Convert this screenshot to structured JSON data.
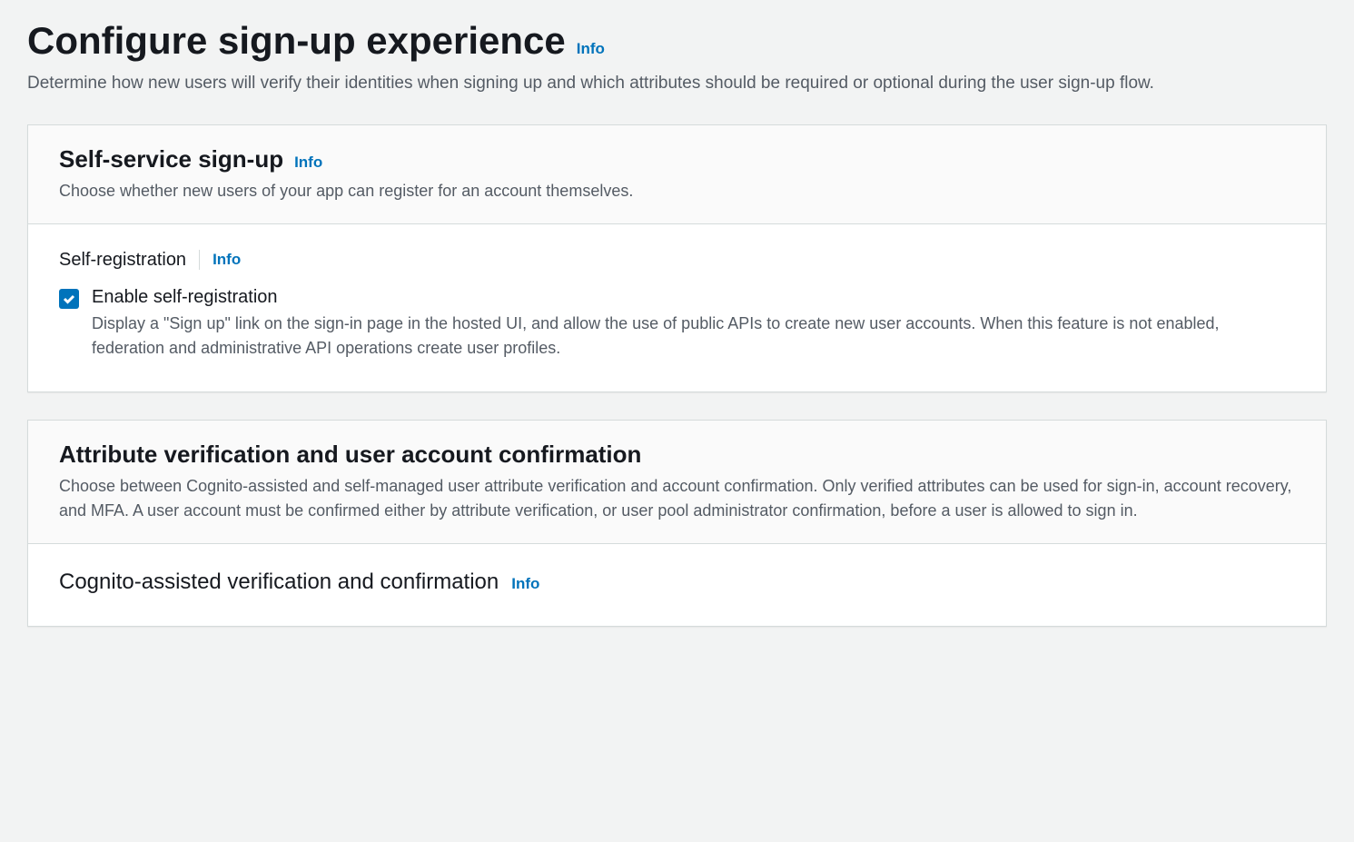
{
  "page": {
    "title": "Configure sign-up experience",
    "info_label": "Info",
    "description": "Determine how new users will verify their identities when signing up and which attributes should be required or optional during the user sign-up flow."
  },
  "panels": {
    "self_service": {
      "title": "Self-service sign-up",
      "info_label": "Info",
      "description": "Choose whether new users of your app can register for an account themselves.",
      "field": {
        "label": "Self-registration",
        "info_label": "Info",
        "checkbox": {
          "checked": true,
          "label": "Enable self-registration",
          "description": "Display a \"Sign up\" link on the sign-in page in the hosted UI, and allow the use of public APIs to create new user accounts. When this feature is not enabled, federation and administrative API operations create user profiles."
        }
      }
    },
    "verification": {
      "title": "Attribute verification and user account confirmation",
      "description": "Choose between Cognito-assisted and self-managed user attribute verification and account confirmation. Only verified attributes can be used for sign-in, account recovery, and MFA. A user account must be confirmed either by attribute verification, or user pool administrator confirmation, before a user is allowed to sign in.",
      "subsection": {
        "title": "Cognito-assisted verification and confirmation",
        "info_label": "Info"
      }
    }
  }
}
